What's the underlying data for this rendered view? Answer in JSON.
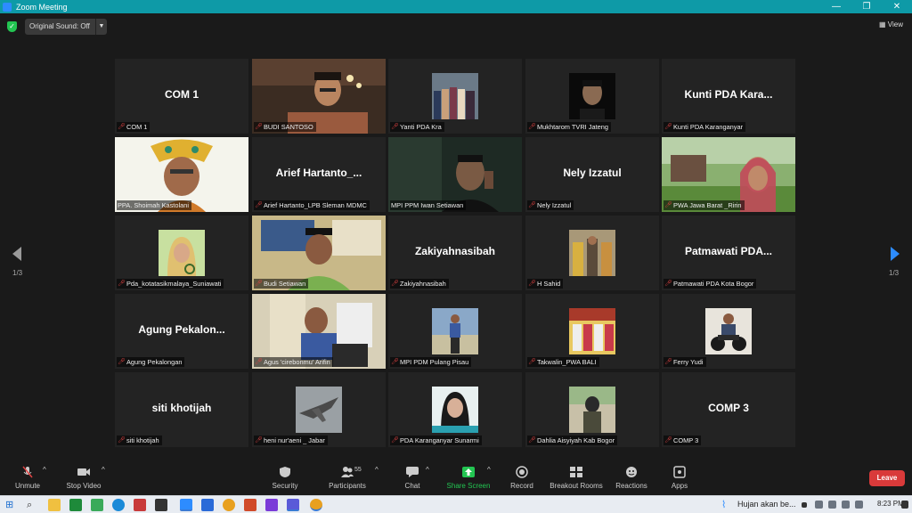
{
  "window": {
    "title": "Zoom Meeting",
    "controls": [
      "—",
      "❐",
      "✕"
    ]
  },
  "topbar": {
    "sound_label": "Original Sound: Off",
    "view_label": "View"
  },
  "pagination": {
    "left": "1/3",
    "right": "1/3"
  },
  "tiles": [
    {
      "big": "COM 1",
      "label": "COM 1"
    },
    {
      "big": "",
      "label": "BUDI SANTOSO"
    },
    {
      "big": "",
      "label": "Yanti PDA Kra"
    },
    {
      "big": "",
      "label": "Mukhtarom TVRI Jateng"
    },
    {
      "big": "Kunti PDA Kara...",
      "label": "Kunti PDA Karanganyar"
    },
    {
      "big": "",
      "label": "PPA. Shoimah Kastolani"
    },
    {
      "big": "Arief Hartanto_...",
      "label": "Arief Hartanto_LPB Sleman MDMC"
    },
    {
      "big": "",
      "label": "MPI PPM Iwan Setiawan"
    },
    {
      "big": "Nely Izzatul",
      "label": "Nely Izzatul"
    },
    {
      "big": "",
      "label": "PWA Jawa Barat _Ririn"
    },
    {
      "big": "",
      "label": "Pda_kotatasikmalaya_Suniawati"
    },
    {
      "big": "",
      "label": "Budi Setiawan"
    },
    {
      "big": "Zakiyahnasibah",
      "label": "Zakiyahnasibah"
    },
    {
      "big": "",
      "label": "H Sahid"
    },
    {
      "big": "Patmawati PDA...",
      "label": "Patmawati PDA Kota Bogor"
    },
    {
      "big": "Agung Pekalon...",
      "label": "Agung Pekalongan"
    },
    {
      "big": "",
      "label": "Agus 'cirebonmu' Arifin"
    },
    {
      "big": "",
      "label": "MPI PDM Pulang Pisau"
    },
    {
      "big": "",
      "label": "Takwalin_PWA BALI"
    },
    {
      "big": "",
      "label": "Ferry Yudi"
    },
    {
      "big": "siti khotijah",
      "label": "siti khotijah"
    },
    {
      "big": "",
      "label": "heni nur'aeni _ Jabar"
    },
    {
      "big": "",
      "label": "PDA Karanganyar Sunarmi"
    },
    {
      "big": "",
      "label": "Dahlia Aisyiyah Kab Bogor"
    },
    {
      "big": "COMP 3",
      "label": "COMP 3"
    }
  ],
  "toolbar": {
    "unmute": "Unmute",
    "stop_video": "Stop Video",
    "security": "Security",
    "participants": "Participants",
    "participants_count": "55",
    "chat": "Chat",
    "share_screen": "Share Screen",
    "record": "Record",
    "breakout": "Breakout Rooms",
    "reactions": "Reactions",
    "apps": "Apps",
    "leave": "Leave"
  },
  "taskbar": {
    "weather": "Hujan akan be...",
    "time": "8:23 PM"
  },
  "colors": {
    "titlebar": "#0e9aa7",
    "active_speaker": "#c6d93f",
    "leave": "#d93a3a",
    "share": "#23c552",
    "nav_arrow": "#2d8cff"
  }
}
